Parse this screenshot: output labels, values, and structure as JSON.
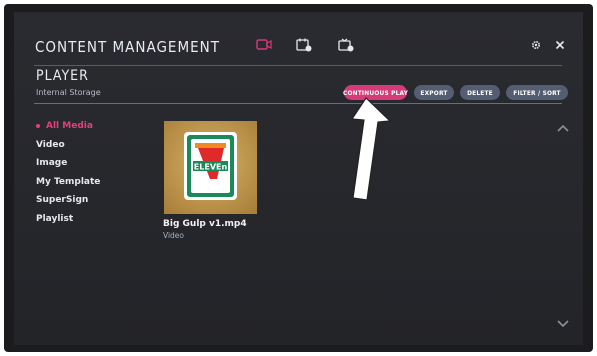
{
  "header": {
    "title": "CONTENT MANAGEMENT",
    "icons": [
      "player-icon",
      "scheduler-icon",
      "template-icon"
    ],
    "settings_icon": "gear-icon",
    "close_icon": "close-icon"
  },
  "section": {
    "title": "PLAYER",
    "subtitle": "Internal Storage"
  },
  "actions": {
    "continuous_play": "CONTINUOUS PLAY",
    "export": "EXPORT",
    "delete": "DELETE",
    "filter_sort": "FILTER / SORT"
  },
  "sidebar": {
    "items": [
      {
        "label": "All Media",
        "active": true
      },
      {
        "label": "Video",
        "active": false
      },
      {
        "label": "Image",
        "active": false
      },
      {
        "label": "My Template",
        "active": false
      },
      {
        "label": "SuperSign",
        "active": false
      },
      {
        "label": "Playlist",
        "active": false
      }
    ]
  },
  "media": {
    "items": [
      {
        "name": "Big Gulp v1.mp4",
        "type": "Video",
        "thumb_logo": "ELEVEn",
        "thumb_numeral": "7"
      }
    ]
  },
  "colors": {
    "accent": "#d63a78",
    "secondary_button": "#555d73",
    "background": "#26272c"
  }
}
